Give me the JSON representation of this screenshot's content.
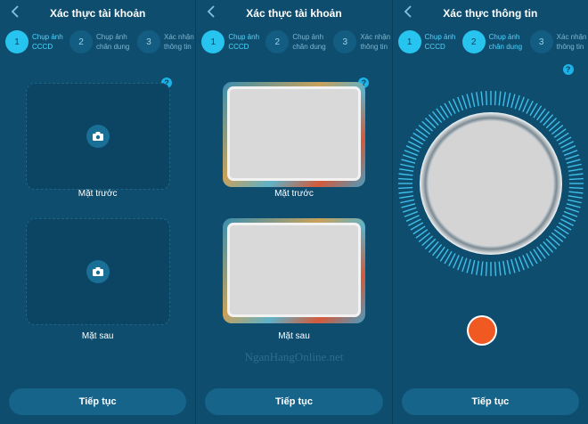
{
  "screens": [
    {
      "title": "Xác thực tài khoản",
      "steps": [
        {
          "num": "1",
          "label": "Chụp ảnh CCCD",
          "state": "active"
        },
        {
          "num": "2",
          "label": "Chụp ảnh chân dung",
          "state": "inactive"
        },
        {
          "num": "3",
          "label": "Xác nhận thông tin",
          "state": "inactive"
        }
      ],
      "front_caption": "Mặt trước",
      "back_caption": "Mặt sau",
      "button": "Tiếp tục"
    },
    {
      "title": "Xác thực tài khoản",
      "steps": [
        {
          "num": "1",
          "label": "Chụp ảnh CCCD",
          "state": "active"
        },
        {
          "num": "2",
          "label": "Chụp ảnh chân dung",
          "state": "inactive"
        },
        {
          "num": "3",
          "label": "Xác nhận thông tin",
          "state": "inactive"
        }
      ],
      "front_caption": "Mặt trước",
      "back_caption": "Mặt sau",
      "button": "Tiếp tục",
      "watermark": "NganHangOnline.net"
    },
    {
      "title": "Xác thực thông tin",
      "steps": [
        {
          "num": "1",
          "label": "Chụp ảnh CCCD",
          "state": "active"
        },
        {
          "num": "2",
          "label": "Chụp ảnh chân dung",
          "state": "active"
        },
        {
          "num": "3",
          "label": "Xác nhận thông tin",
          "state": "inactive"
        }
      ],
      "button": "Tiếp tục"
    }
  ],
  "help_symbol": "?",
  "colors": {
    "background": "#0f4d6f",
    "accent": "#27c4f0",
    "button": "#16648a",
    "shutter": "#f05a22"
  },
  "icons": [
    "back-chevron-icon",
    "camera-icon",
    "help-icon"
  ]
}
